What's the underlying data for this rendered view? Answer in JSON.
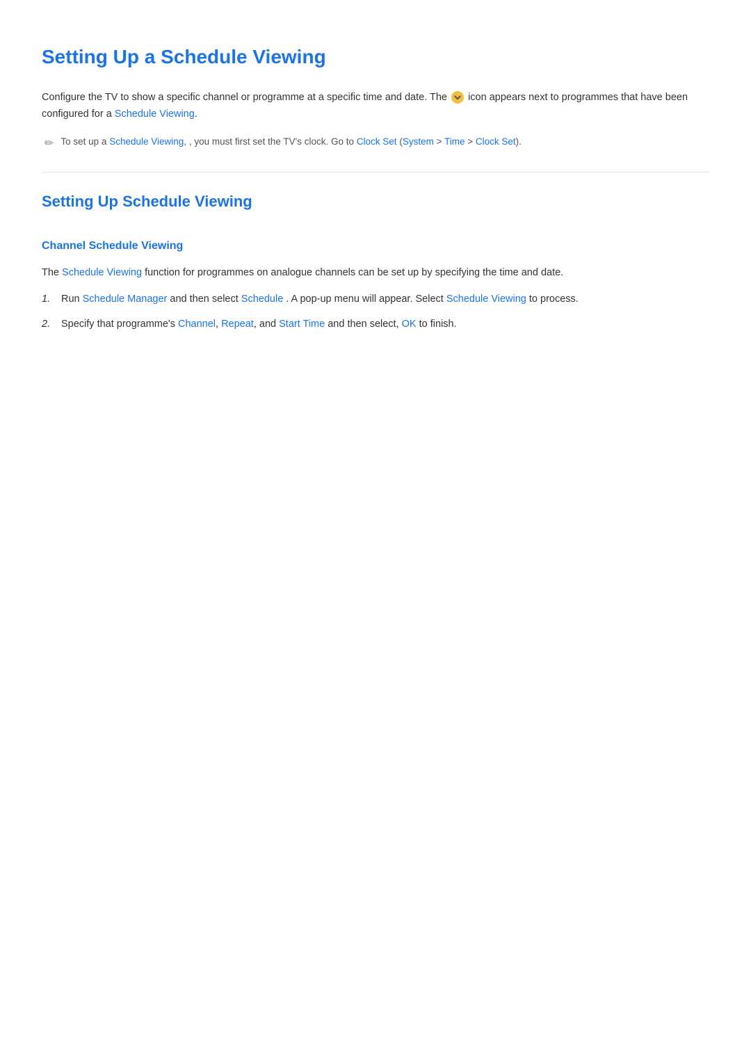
{
  "page": {
    "main_title": "Setting Up a Schedule Viewing",
    "intro": {
      "text_before_icon": "Configure the TV to show a specific channel or programme at a specific time and date. The",
      "text_after_icon": "icon appears next to programmes that have been configured for a",
      "schedule_viewing_link": "Schedule Viewing",
      "text_end": "."
    },
    "note": {
      "text_prefix": "To set up a",
      "schedule_viewing_link": "Schedule Viewing",
      "text_middle": ", you must first set the TV's clock. Go to",
      "clock_set_link": "Clock Set",
      "system_link": "System",
      "time_link": "Time",
      "clock_set_link2": "Clock Set",
      "text_end": ")."
    },
    "section_title": "Setting Up Schedule Viewing",
    "subsection_title": "Channel Schedule Viewing",
    "channel_intro": {
      "text_before": "The",
      "schedule_viewing_link": "Schedule Viewing",
      "text_after": "function for programmes on analogue channels can be set up by specifying the time and date."
    },
    "steps": [
      {
        "number": "1.",
        "text_prefix": "Run",
        "schedule_manager_link": "Schedule Manager",
        "text_middle": "and then select",
        "schedule_link": "Schedule",
        "text_after": ". A pop-up menu will appear. Select",
        "schedule_viewing_link": "Schedule Viewing",
        "text_end": "to process."
      },
      {
        "number": "2.",
        "text_prefix": "Specify that programme's",
        "channel_link": "Channel",
        "repeat_link": "Repeat",
        "start_time_link": "Start Time",
        "text_middle": "and then select,",
        "ok_link": "OK",
        "text_end": "to finish."
      }
    ]
  }
}
